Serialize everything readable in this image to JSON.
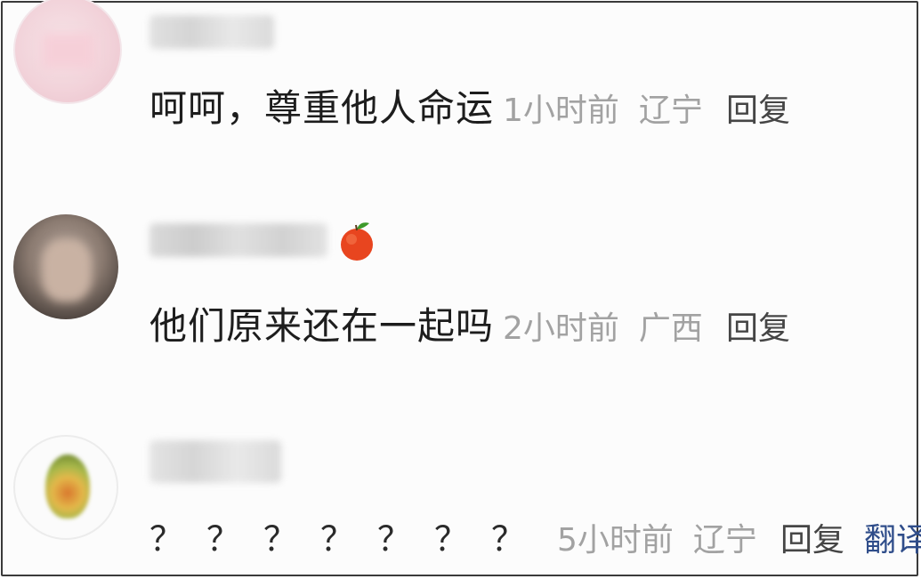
{
  "comments": [
    {
      "avatar_icon": "pink-blurred-avatar-icon",
      "text": "呵呵，尊重他人命运",
      "time": "1小时前",
      "location": "辽宁",
      "reply_label": "回复"
    },
    {
      "avatar_icon": "blurred-person-avatar-icon",
      "badge_icon": "apple-badge-icon",
      "text": "他们原来还在一起吗",
      "time": "2小时前",
      "location": "广西",
      "reply_label": "回复"
    },
    {
      "avatar_icon": "fruit-avatar-icon",
      "text": "？？？？？？？",
      "time": "5小时前",
      "location": "辽宁",
      "reply_label": "回复",
      "translate_label": "翻译"
    }
  ],
  "colors": {
    "text": "#1d1d1d",
    "meta": "#a2a2a2",
    "reply": "#454545",
    "translate": "#2f4d8a",
    "border": "#3a3a3a"
  }
}
